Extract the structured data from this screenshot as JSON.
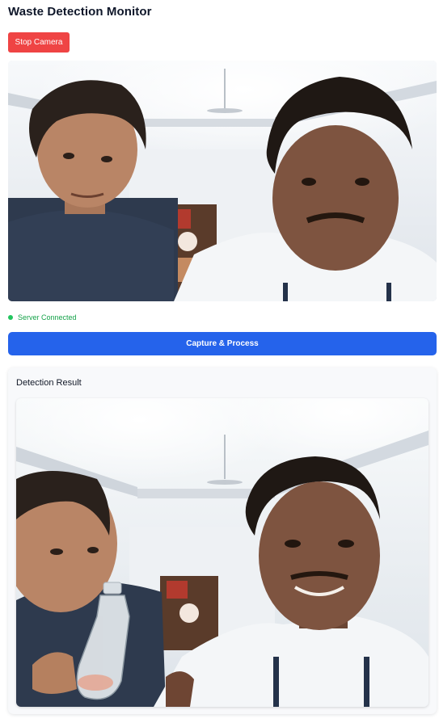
{
  "header": {
    "title": "Waste Detection Monitor"
  },
  "controls": {
    "stop_camera_label": "Stop Camera",
    "capture_label": "Capture & Process"
  },
  "status": {
    "text": "Server Connected",
    "color": "#22c55e"
  },
  "result": {
    "title": "Detection Result"
  },
  "colors": {
    "stop_button": "#ef4444",
    "capture_button": "#2563eb",
    "card_background": "#f8f9fb"
  }
}
